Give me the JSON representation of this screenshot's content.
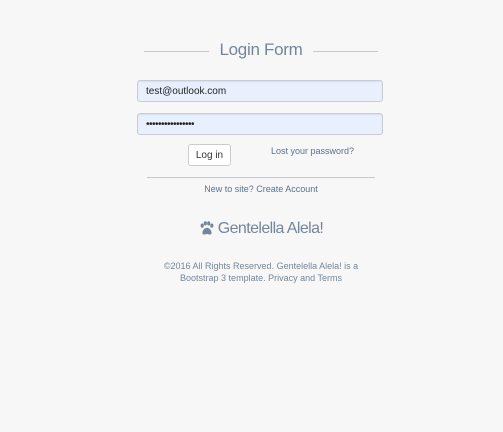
{
  "header": {
    "title": "Login Form"
  },
  "form": {
    "email_value": "test@outlook.com",
    "password_value": "••••••••••••••••",
    "login_button": "Log in",
    "lost_password": "Lost your password?"
  },
  "register": {
    "prefix": "New to site?",
    "link": "Create Account"
  },
  "brand": {
    "icon": "paw-icon",
    "name": "Gentelella Alela!"
  },
  "footer": {
    "copyright": "©2016 All Rights Reserved. Gentelella Alela! is a Bootstrap 3 template. Privacy and Terms"
  }
}
